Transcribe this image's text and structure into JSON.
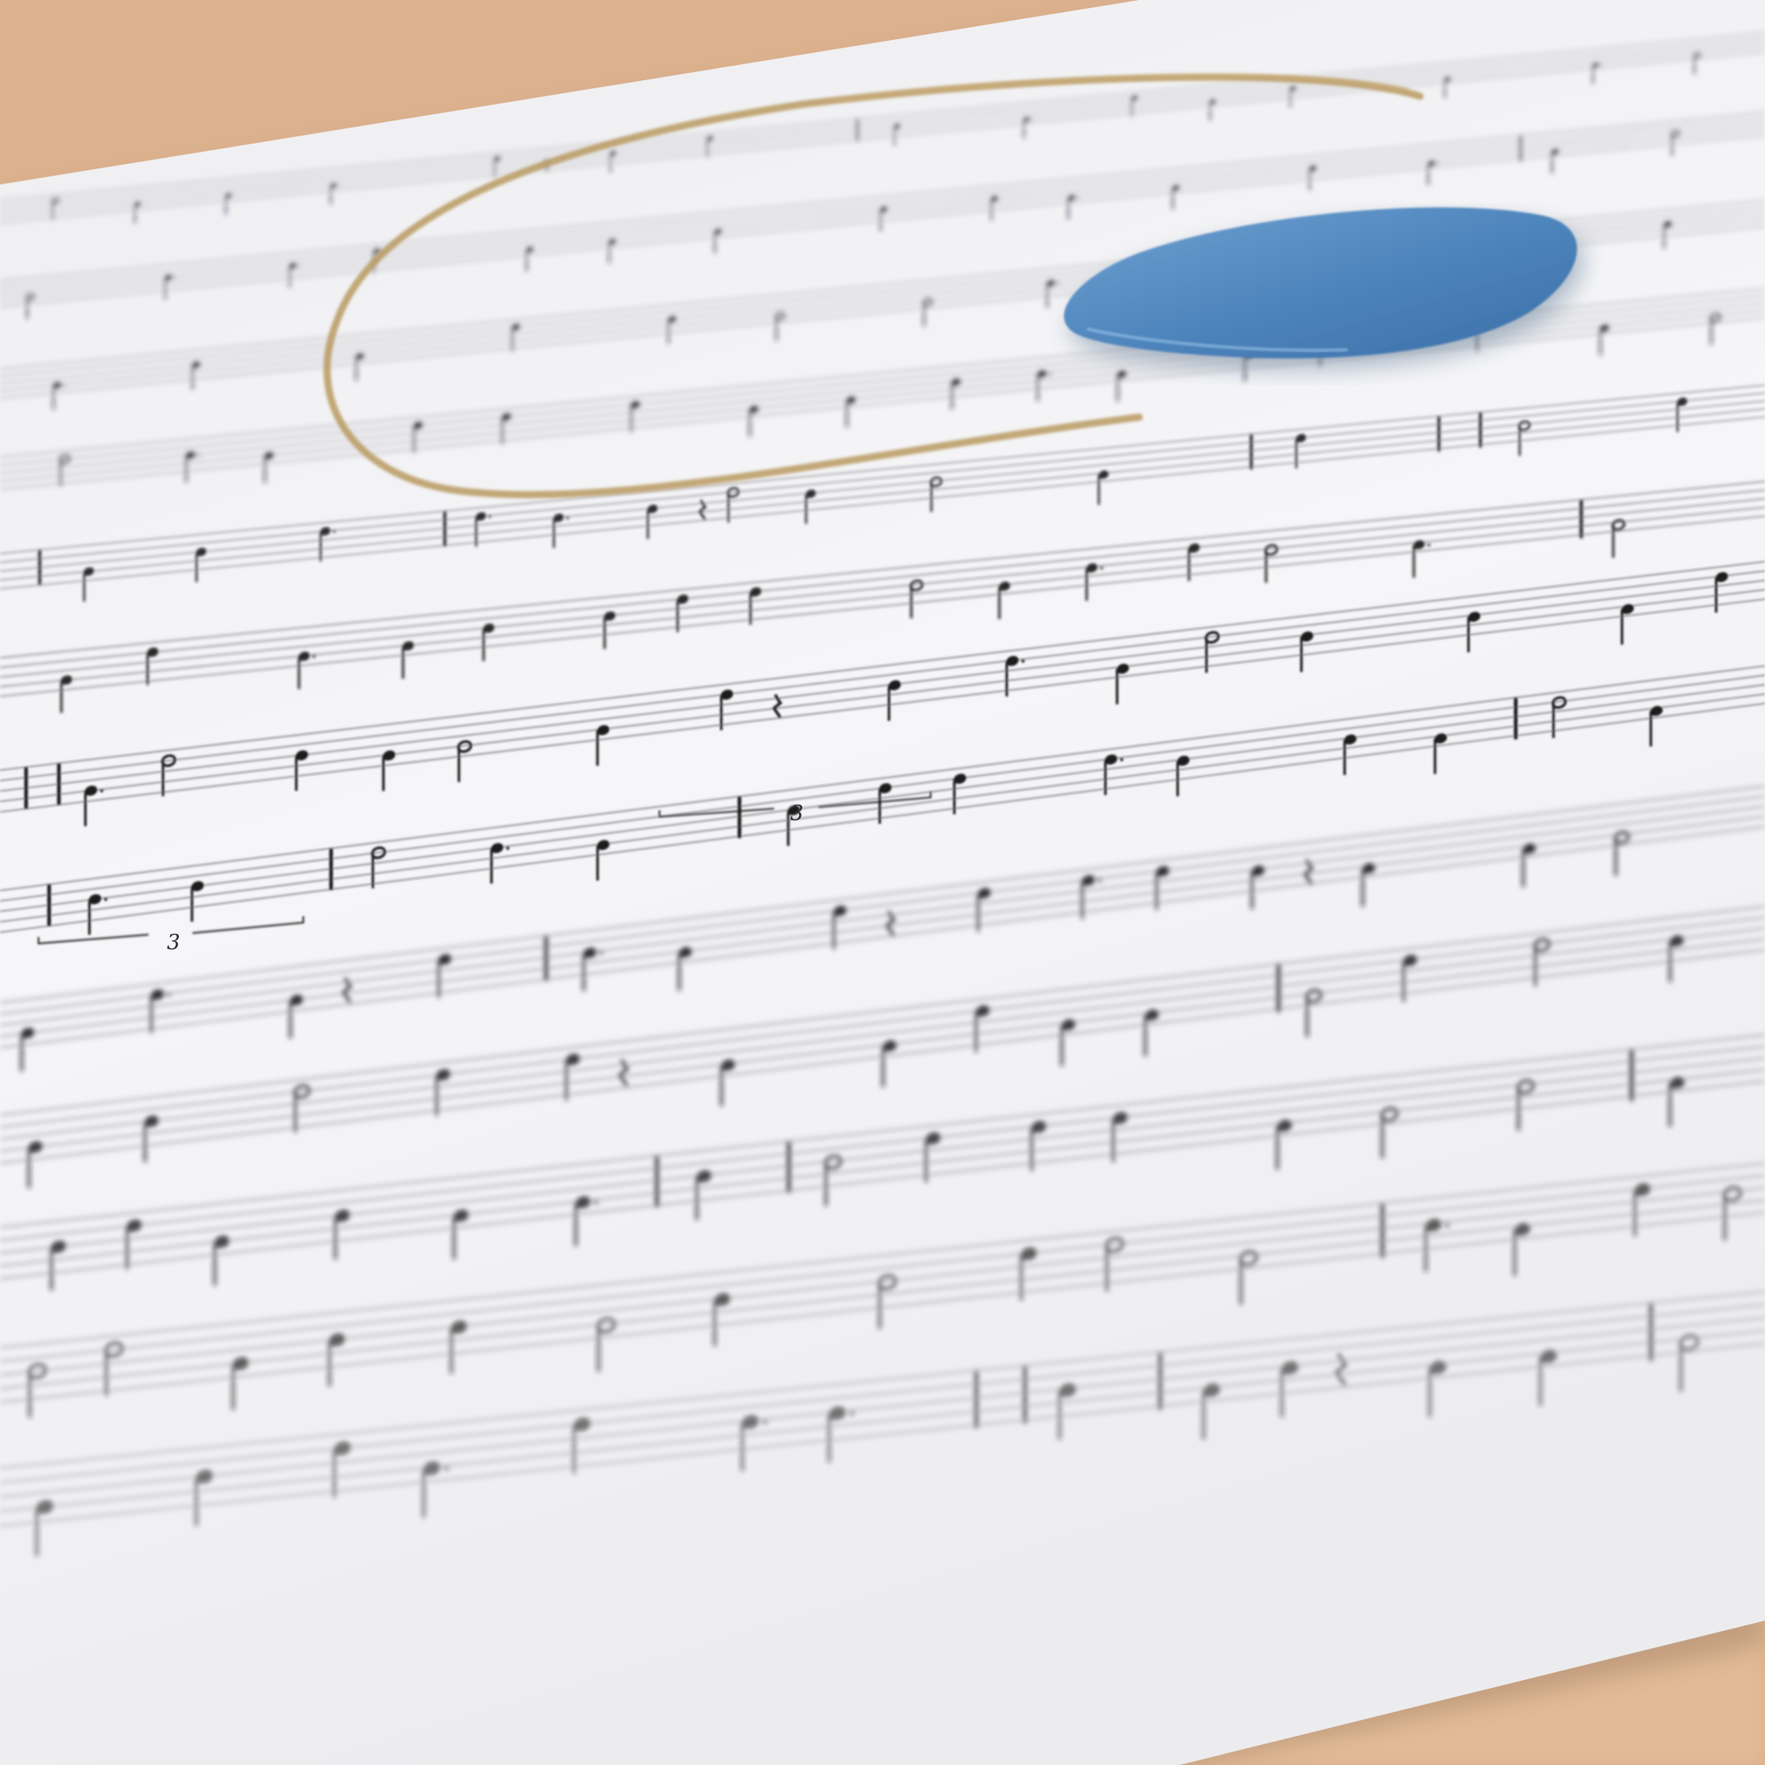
{
  "photo": {
    "subject": "sheet-music-page",
    "colors": {
      "table": "#dcb18e",
      "paper": "#f3f3f5",
      "staff_line": "#9a9aa0",
      "ink": "#1b1b1f",
      "coffee_ring": "#b99a62",
      "guitar_pick": "#4f86be"
    }
  },
  "sheet": {
    "triplet_labels": [
      "3",
      "3"
    ]
  },
  "objects": [
    "coffee-ring-stain",
    "guitar-pick-icon"
  ]
}
